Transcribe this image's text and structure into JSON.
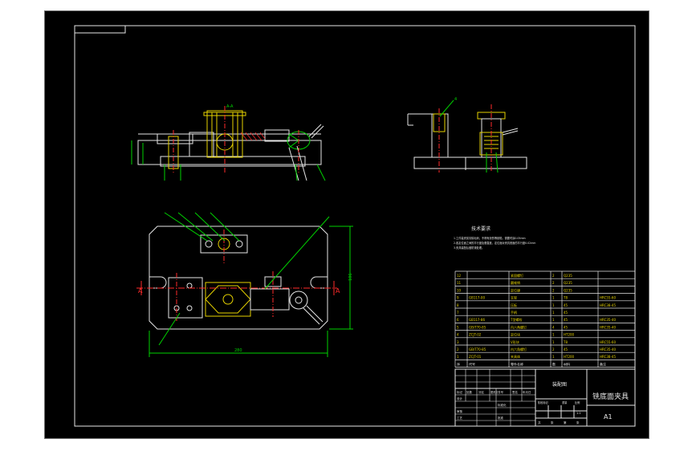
{
  "sheet": {
    "title_cn": "铣底面夹具",
    "size": "A1",
    "drawing_name": "装配图"
  },
  "tech_req": {
    "heading": "技术要求",
    "lines": [
      "1.工件装夹前清除毛刺，不得有划伤等缺陷，需要时涂0.05mm",
      "2.各定位面之间的平行度及垂直度，定位面对夹具底面的平行度0.02mm",
      "3.夹具装配后做防锈处理。"
    ]
  },
  "bom": {
    "rows": [
      {
        "no": "12",
        "code": "",
        "name": "紧固螺钉",
        "qty": "2",
        "material": "Q235",
        "note": ""
      },
      {
        "no": "11",
        "code": "",
        "name": "圆锥销",
        "qty": "2",
        "material": "Q235",
        "note": ""
      },
      {
        "no": "10",
        "code": "",
        "name": "定位键",
        "qty": "2",
        "material": "Q235",
        "note": ""
      },
      {
        "no": "9",
        "code": "GB117-00",
        "name": "支架",
        "qty": "1",
        "material": "T8",
        "note": "HRC55-60"
      },
      {
        "no": "8",
        "code": "",
        "name": "压板",
        "qty": "1",
        "material": "45",
        "note": "HRC38-45"
      },
      {
        "no": "7",
        "code": "",
        "name": "手柄",
        "qty": "1",
        "material": "45",
        "note": ""
      },
      {
        "no": "6",
        "code": "GB117-86",
        "name": "T型螺栓",
        "qty": "1",
        "material": "45",
        "note": "HRC35-40"
      },
      {
        "no": "5",
        "code": "GB/T70-85",
        "name": "内六角螺钉",
        "qty": "4",
        "material": "45",
        "note": "HRC35-40"
      },
      {
        "no": "4",
        "code": "ZCJT-02",
        "name": "定位块",
        "qty": "1",
        "material": "HT200",
        "note": ""
      },
      {
        "no": "3",
        "code": "",
        "name": "V形块",
        "qty": "1",
        "material": "T8",
        "note": "HRC55-60"
      },
      {
        "no": "2",
        "code": "GB/T70-85",
        "name": "内六角螺钉",
        "qty": "2",
        "material": "45",
        "note": "HRC35-40"
      },
      {
        "no": "1",
        "code": "ZCJT-01",
        "name": "夹具体",
        "qty": "1",
        "material": "HT200",
        "note": "HRC38-45"
      }
    ],
    "header": {
      "no": "序",
      "code": "代号",
      "name": "零件名称",
      "qty": "数",
      "material": "材料",
      "note": "备注"
    }
  },
  "title_block": {
    "labels": [
      "标记",
      "处数",
      "分区",
      "更改文件号",
      "签名",
      "年月日"
    ],
    "rows": [
      "设计",
      "审核",
      "工艺"
    ],
    "extra": [
      "标准化",
      "批准"
    ],
    "stage_labels": [
      "阶段标记",
      "重量",
      "比例"
    ],
    "scale": "1:1",
    "sheets": [
      "共",
      "张",
      "第",
      "张"
    ]
  },
  "dims": {
    "front_width": "280",
    "height": "106"
  },
  "colors": {
    "line_white": "#e6e6e6",
    "line_yellow": "#e6d200",
    "line_green": "#00d200",
    "line_red": "#ff2a2a",
    "line_gray": "#888888",
    "frame_border": "#6f6f6f"
  }
}
